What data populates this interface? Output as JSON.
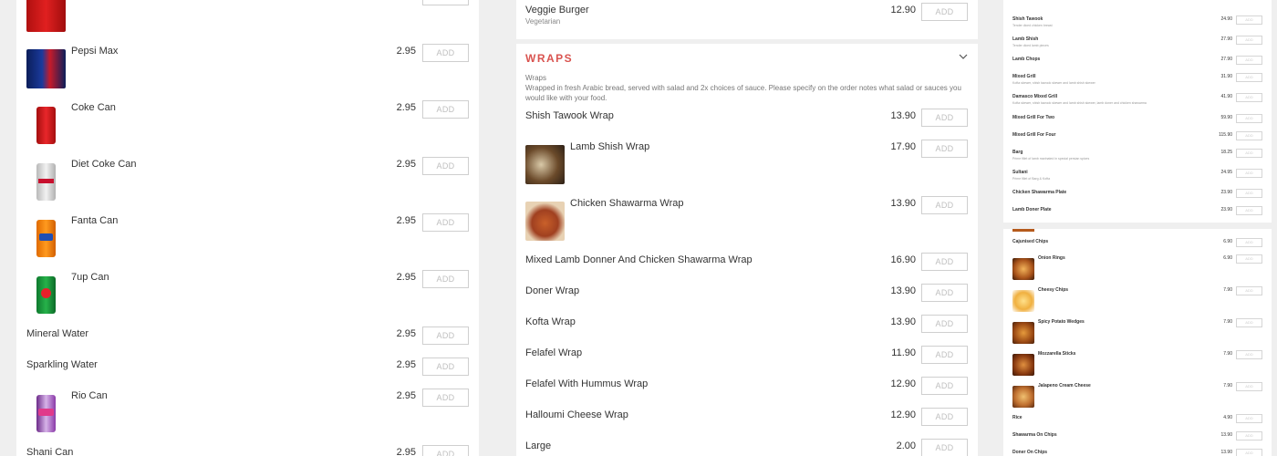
{
  "add_label": "ADD",
  "left": {
    "items": [
      {
        "name": "Pepsi Max",
        "price": "2.95",
        "icon": "pepsi-max-can"
      },
      {
        "name": "Coke Can",
        "price": "2.95",
        "icon": "coke-can"
      },
      {
        "name": "Diet Coke Can",
        "price": "2.95",
        "icon": "diet-coke-can"
      },
      {
        "name": "Fanta Can",
        "price": "2.95",
        "icon": "fanta-can"
      },
      {
        "name": "7up Can",
        "price": "2.95",
        "icon": "7up-can"
      },
      {
        "name": "Mineral Water",
        "price": "2.95"
      },
      {
        "name": "Sparkling Water",
        "price": "2.95"
      },
      {
        "name": "Rio Can",
        "price": "2.95",
        "icon": "rio-can"
      },
      {
        "name": "Shani Can",
        "price": "2.95"
      }
    ]
  },
  "veggie": {
    "name": "Veggie Burger",
    "sub": "Vegetarian",
    "price": "12.90"
  },
  "wraps": {
    "title": "WRAPS",
    "desc_title": "Wraps",
    "desc": "Wrapped in fresh Arabic bread, served with salad and 2x choices of sauce. Please specify on the order notes what salad or sauces you would like with your food.",
    "items": [
      {
        "name": "Shish Tawook Wrap",
        "price": "13.90"
      },
      {
        "name": "Lamb Shish Wrap",
        "price": "17.90",
        "icon": "lamb-shish-wrap-photo"
      },
      {
        "name": "Chicken Shawarma Wrap",
        "price": "13.90",
        "icon": "chicken-shawarma-wrap-photo"
      },
      {
        "name": "Mixed Lamb Donner And Chicken Shawarma Wrap",
        "price": "16.90"
      },
      {
        "name": "Doner Wrap",
        "price": "13.90"
      },
      {
        "name": "Kofta Wrap",
        "price": "13.90"
      },
      {
        "name": "Felafel Wrap",
        "price": "11.90"
      },
      {
        "name": "Felafel With Hummus Wrap",
        "price": "12.90"
      },
      {
        "name": "Halloumi Cheese Wrap",
        "price": "12.90"
      },
      {
        "name": "Large",
        "price": "2.00"
      }
    ]
  },
  "right_top": {
    "items": [
      {
        "name": "Shish Tawook",
        "sub": "Tender diced chicken breast",
        "price": "24.90"
      },
      {
        "name": "Lamb Shish",
        "sub": "Tender diced lamb pieces",
        "price": "27.90"
      },
      {
        "name": "Lamb Chops",
        "price": "27.90"
      },
      {
        "name": "Mixed Grill",
        "sub": "Kofta skewer, shish tawook skewer and lamb shish skewer",
        "price": "31.90"
      },
      {
        "name": "Damasco Mixed Grill",
        "sub": "Kofta skewer, shish tawook skewer and lamb shish skewer, lamb doner and chicken shawarma",
        "price": "41.90"
      },
      {
        "name": "Mixed Grill For Two",
        "price": "59.90"
      },
      {
        "name": "Mixed Grill For Four",
        "price": "115.90"
      },
      {
        "name": "Barg",
        "sub": "Prime fillet of lamb marinated in special persian spices",
        "price": "18.25"
      },
      {
        "name": "Sultani",
        "sub": "Prime fillet of Barg & Kofta",
        "price": "24.95"
      },
      {
        "name": "Chicken Shawarma Plate",
        "price": "23.90"
      },
      {
        "name": "Lamb Doner Plate",
        "price": "23.90"
      }
    ]
  },
  "right_bot": {
    "items": [
      {
        "name": "Cajunised Chips",
        "price": "6.90"
      },
      {
        "name": "Onion Rings",
        "price": "6.90",
        "icon": "onion-rings-photo"
      },
      {
        "name": "Cheesy Chips",
        "price": "7.90",
        "icon": "cheesy-chips-photo"
      },
      {
        "name": "Spicy Potato Wedges",
        "price": "7.90",
        "icon": "potato-wedges-photo"
      },
      {
        "name": "Mozzarella Sticks",
        "price": "7.90",
        "icon": "mozzarella-sticks-photo"
      },
      {
        "name": "Jalapeno Cream Cheese",
        "price": "7.90",
        "icon": "jalapeno-photo"
      },
      {
        "name": "Rice",
        "price": "4.90"
      },
      {
        "name": "Shawarma On Chips",
        "price": "13.90"
      },
      {
        "name": "Doner On Chips",
        "price": "13.90"
      }
    ]
  },
  "colors": {
    "accent": "#d9534f",
    "background": "#efefef"
  }
}
